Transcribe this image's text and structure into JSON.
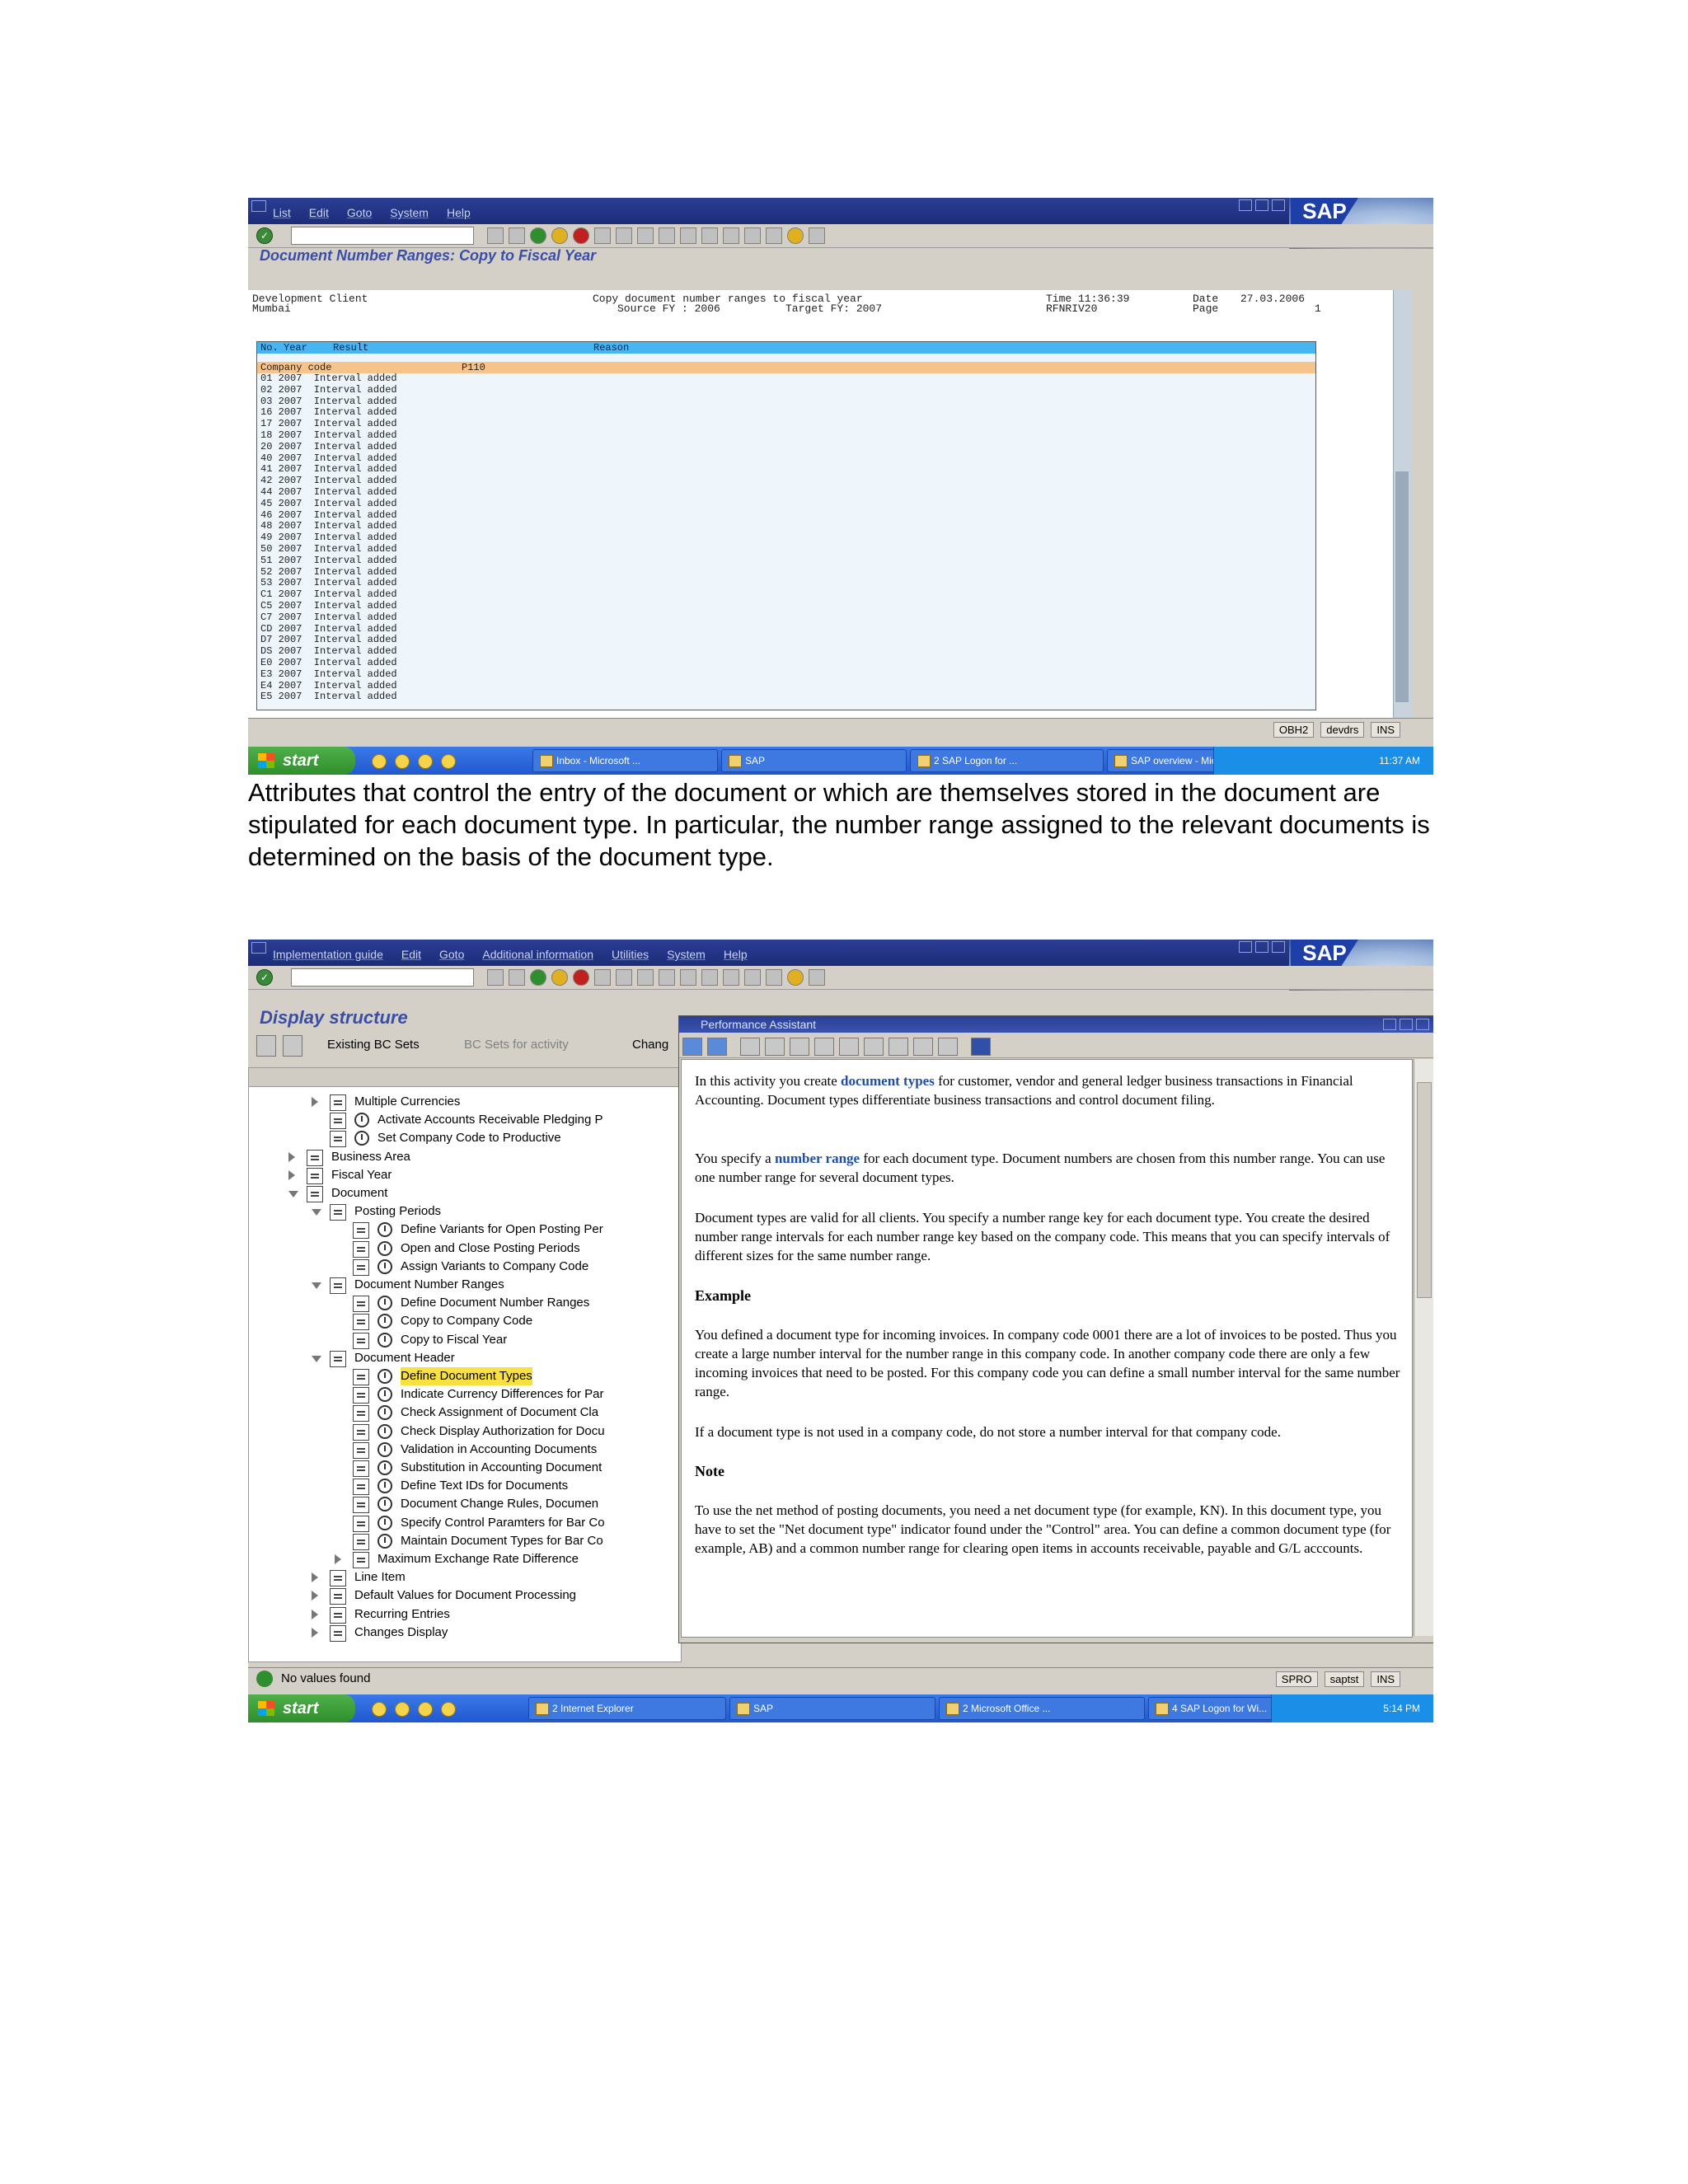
{
  "shot1": {
    "menu": [
      "List",
      "Edit",
      "Goto",
      "System",
      "Help"
    ],
    "logo": "SAP",
    "title": "Document Number Ranges: Copy to Fiscal Year",
    "report": {
      "client": "Development Client",
      "city": "Mumbai",
      "heading": "Copy document number ranges to fiscal year",
      "source": "Source FY : 2006",
      "target": "Target FY: 2007",
      "time_label": "Time 11:36:39",
      "program": "RFNRIV20",
      "date_label": "Date",
      "date": "27.03.2006",
      "page_label": "Page",
      "page": "1",
      "col_no": "No.",
      "col_year": "Year",
      "col_result": "Result",
      "col_reason": "Reason",
      "cc_label": "Company code",
      "cc_value": "P110",
      "rows": [
        "01 2007  Interval added",
        "02 2007  Interval added",
        "03 2007  Interval added",
        "16 2007  Interval added",
        "17 2007  Interval added",
        "18 2007  Interval added",
        "20 2007  Interval added",
        "40 2007  Interval added",
        "41 2007  Interval added",
        "42 2007  Interval added",
        "44 2007  Interval added",
        "45 2007  Interval added",
        "46 2007  Interval added",
        "48 2007  Interval added",
        "49 2007  Interval added",
        "50 2007  Interval added",
        "51 2007  Interval added",
        "52 2007  Interval added",
        "53 2007  Interval added",
        "C1 2007  Interval added",
        "C5 2007  Interval added",
        "C7 2007  Interval added",
        "CD 2007  Interval added",
        "D7 2007  Interval added",
        "DS 2007  Interval added",
        "E0 2007  Interval added",
        "E3 2007  Interval added",
        "E4 2007  Interval added",
        "E5 2007  Interval added"
      ]
    },
    "status": {
      "tcode": "OBH2",
      "server": "devdrs",
      "mode": "INS"
    },
    "taskbar": {
      "start": "start",
      "tasks": [
        "Inbox - Microsoft ...",
        "SAP",
        "2 SAP Logon for ...",
        "SAP overview - Mic..."
      ],
      "time": "11:37 AM"
    }
  },
  "caption": "Attributes that control the entry of the document or which are themselves stored in the document are stipulated for each document type. In particular, the number range assigned to the relevant documents is determined on the basis of the document type.",
  "shot2": {
    "menu": [
      "Implementation guide",
      "Edit",
      "Goto",
      "Additional information",
      "Utilities",
      "System",
      "Help"
    ],
    "logo": "SAP",
    "title": "Display structure",
    "appbar": {
      "existing": "Existing BC Sets",
      "bcsets": "BC Sets for activity",
      "change": "Chang"
    },
    "tree": [
      {
        "label": "Multiple Currencies",
        "level": 4,
        "arrow": "right",
        "clock": false,
        "hl": false
      },
      {
        "label": "Activate Accounts Receivable Pledging P",
        "level": 4,
        "arrow": "none",
        "clock": true,
        "hl": false
      },
      {
        "label": "Set Company Code to Productive",
        "level": 4,
        "arrow": "none",
        "clock": true,
        "hl": false
      },
      {
        "label": "Business Area",
        "level": 3,
        "arrow": "right",
        "clock": false,
        "hl": false
      },
      {
        "label": "Fiscal Year",
        "level": 3,
        "arrow": "right",
        "clock": false,
        "hl": false
      },
      {
        "label": "Document",
        "level": 3,
        "arrow": "down",
        "clock": false,
        "hl": false
      },
      {
        "label": "Posting Periods",
        "level": 4,
        "arrow": "down",
        "clock": false,
        "hl": false
      },
      {
        "label": "Define Variants for Open Posting Per",
        "level": 5,
        "arrow": "none",
        "clock": true,
        "hl": false
      },
      {
        "label": "Open and Close Posting Periods",
        "level": 5,
        "arrow": "none",
        "clock": true,
        "hl": false
      },
      {
        "label": "Assign Variants to Company Code",
        "level": 5,
        "arrow": "none",
        "clock": true,
        "hl": false
      },
      {
        "label": "Document Number Ranges",
        "level": 4,
        "arrow": "down",
        "clock": false,
        "hl": false
      },
      {
        "label": "Define Document Number Ranges",
        "level": 5,
        "arrow": "none",
        "clock": true,
        "hl": false
      },
      {
        "label": "Copy to Company Code",
        "level": 5,
        "arrow": "none",
        "clock": true,
        "hl": false
      },
      {
        "label": "Copy to Fiscal Year",
        "level": 5,
        "arrow": "none",
        "clock": true,
        "hl": false
      },
      {
        "label": "Document Header",
        "level": 4,
        "arrow": "down",
        "clock": false,
        "hl": false
      },
      {
        "label": "Define Document Types",
        "level": 5,
        "arrow": "none",
        "clock": true,
        "hl": true
      },
      {
        "label": "Indicate Currency Differences for Par",
        "level": 5,
        "arrow": "none",
        "clock": true,
        "hl": false
      },
      {
        "label": "Check Assignment of Document Cla",
        "level": 5,
        "arrow": "none",
        "clock": true,
        "hl": false
      },
      {
        "label": "Check Display Authorization for Docu",
        "level": 5,
        "arrow": "none",
        "clock": true,
        "hl": false
      },
      {
        "label": "Validation in Accounting Documents",
        "level": 5,
        "arrow": "none",
        "clock": true,
        "hl": false
      },
      {
        "label": "Substitution in Accounting Document",
        "level": 5,
        "arrow": "none",
        "clock": true,
        "hl": false
      },
      {
        "label": "Define Text IDs for Documents",
        "level": 5,
        "arrow": "none",
        "clock": true,
        "hl": false
      },
      {
        "label": "Document Change Rules, Documen",
        "level": 5,
        "arrow": "none",
        "clock": true,
        "hl": false
      },
      {
        "label": "Specify Control Paramters for Bar Co",
        "level": 5,
        "arrow": "none",
        "clock": true,
        "hl": false
      },
      {
        "label": "Maintain Document Types for Bar Co",
        "level": 5,
        "arrow": "none",
        "clock": true,
        "hl": false
      },
      {
        "label": "Maximum Exchange Rate Difference",
        "level": 5,
        "arrow": "right",
        "clock": false,
        "hl": false
      },
      {
        "label": "Line Item",
        "level": 4,
        "arrow": "right",
        "clock": false,
        "hl": false
      },
      {
        "label": "Default Values for Document Processing",
        "level": 4,
        "arrow": "right",
        "clock": false,
        "hl": false
      },
      {
        "label": "Recurring Entries",
        "level": 4,
        "arrow": "right",
        "clock": false,
        "hl": false
      },
      {
        "label": "Changes Display",
        "level": 4,
        "arrow": "right",
        "clock": false,
        "hl": false
      }
    ],
    "pa": {
      "title": "Performance Assistant",
      "p1_a": "In this activity you create ",
      "p1_link": "document types",
      "p1_b": " for customer, vendor and general ledger business transactions in Financial Accounting. Document types differentiate business transactions and control document filing.",
      "p2_a": "You specify a ",
      "p2_link": "number range",
      "p2_b": " for each document type. Document numbers are chosen from this number range. You can use one number range for several document types.",
      "p3": "Document types are valid for all clients. You specify a number range key for each document type. You create the desired number range intervals for each number range key based on the company code. This means that you can specify intervals of different sizes for the same number range.",
      "h_example": "Example",
      "p4": "You defined a document type for incoming invoices. In company code 0001 there are a lot of invoices to be posted. Thus you create a large number interval for the number range in this company code. In another company code there are only a few incoming invoices that need to be posted. For this company code you can define a small number interval for the same number range.",
      "p5": "If a document type is not used in a company code, do not store a number interval for that company code.",
      "h_note": "Note",
      "p6": "To use the net method of posting documents, you need a net document type (for example, KN). In this document type, you have to set the \"Net document type\" indicator found under the \"Control\" area. You can define a common document type (for example, AB) and a common number range for clearing open items in accounts receivable, payable and G/L acccounts."
    },
    "status": {
      "message": "No values found",
      "tcode": "SPRO",
      "server": "saptst",
      "mode": "INS"
    },
    "taskbar": {
      "start": "start",
      "tasks": [
        "2 Internet Explorer",
        "SAP",
        "2 Microsoft Office ...",
        "4 SAP Logon for Wi..."
      ],
      "time": "5:14 PM"
    }
  }
}
